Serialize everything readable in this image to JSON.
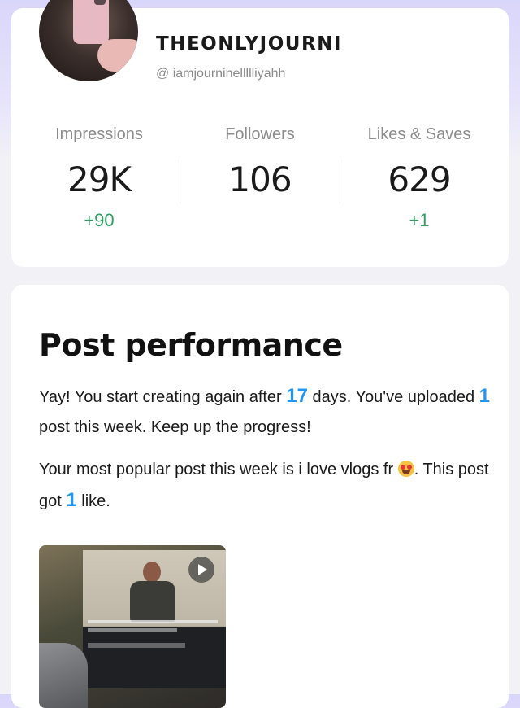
{
  "profile": {
    "username": "THEONLYJOURNI",
    "handle": "@ iamjourninellllliyahh"
  },
  "stats": [
    {
      "label": "Impressions",
      "value": "29K",
      "delta": "+90"
    },
    {
      "label": "Followers",
      "value": "106",
      "delta": ""
    },
    {
      "label": "Likes & Saves",
      "value": "629",
      "delta": "+1"
    }
  ],
  "colors": {
    "accent_number": "#2196f3",
    "delta_green": "#2e9e62"
  },
  "performance": {
    "title": "Post performance",
    "p1_a": "Yay! You start creating again after ",
    "p1_days": "17",
    "p1_b": " days. You've uploaded ",
    "p1_posts": "1",
    "p1_c": " post this week. Keep up the progress!",
    "p2_a": "Your most popular post this week is i love vlogs fr ",
    "p2_emoji": "heart-eyes-emoji",
    "p2_b": ". This post got ",
    "p2_likes": "1",
    "p2_c": " like."
  },
  "thumbnail": {
    "icon": "play-icon"
  }
}
